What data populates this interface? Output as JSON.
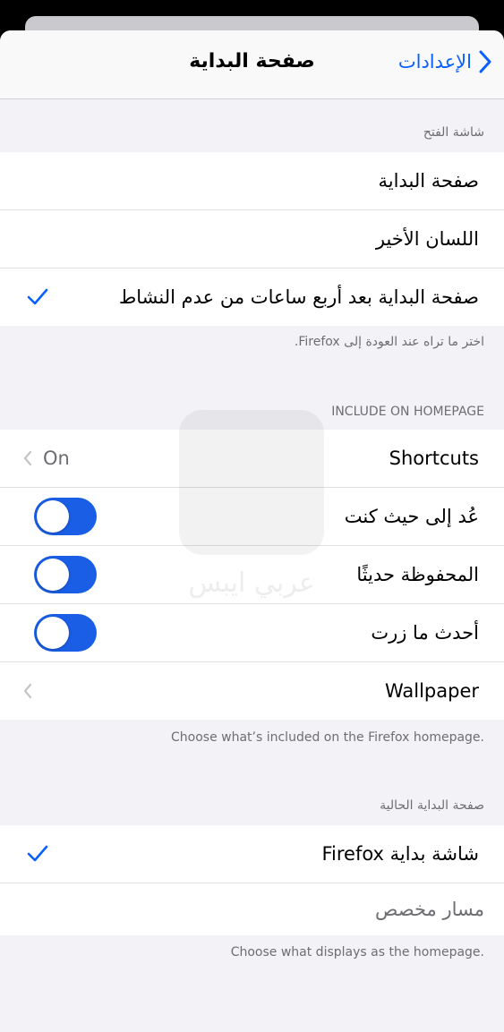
{
  "nav": {
    "title": "صفحة البداية",
    "back_label": "الإعدادات"
  },
  "opening_screen": {
    "header": "شاشة الفتح",
    "options": [
      {
        "label": "صفحة البداية",
        "checked": false
      },
      {
        "label": "اللسان الأخير",
        "checked": false
      },
      {
        "label": "صفحة البداية بعد أربع ساعات من عدم النشاط",
        "checked": true
      }
    ],
    "footer": "اختر ما تراه عند العودة إلى Firefox."
  },
  "include_on_homepage": {
    "header": "INCLUDE ON HOMEPAGE",
    "shortcuts": {
      "label": "Shortcuts",
      "value": "On"
    },
    "toggles": [
      {
        "label": "عُد إلى حيث كنت",
        "on": true
      },
      {
        "label": "المحفوظة حديثًا",
        "on": true
      },
      {
        "label": "أحدث ما زرت",
        "on": true
      }
    ],
    "wallpaper": {
      "label": "Wallpaper"
    },
    "footer": "Choose what’s included on the Firefox homepage."
  },
  "current_homepage": {
    "header": "صفحة البداية الحالية",
    "options": [
      {
        "label": "شاشة بداية Firefox",
        "checked": true
      }
    ],
    "custom_url": {
      "label": "مسار مخصص"
    },
    "footer": "Choose what displays as the homepage."
  },
  "watermark": {
    "text": "عربي ايبس"
  },
  "colors": {
    "accent": "#0a60ff",
    "toggle_on": "#1a5ee6",
    "background": "#f2f2f7"
  }
}
